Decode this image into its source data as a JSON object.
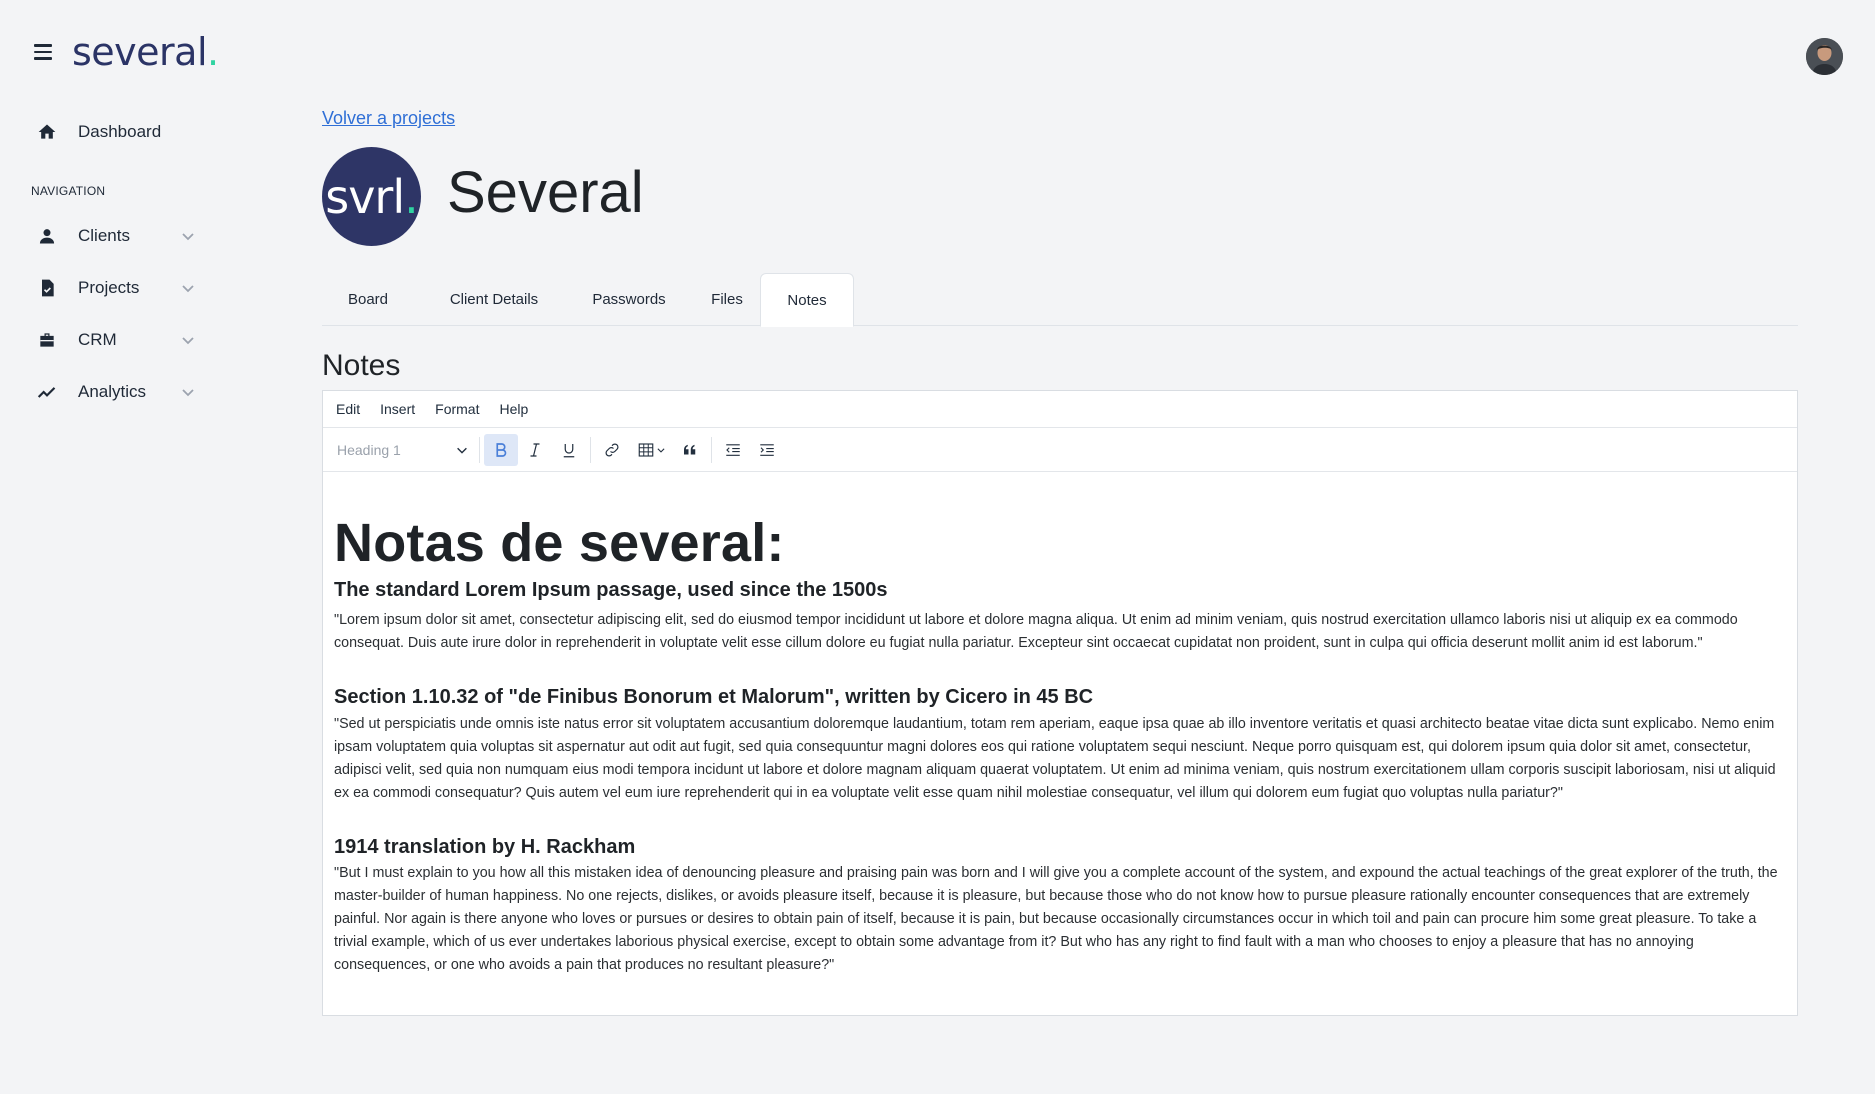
{
  "brand": {
    "name": "several",
    "dot": ".",
    "accent": "#2fd3a1",
    "navy": "#2e3566"
  },
  "sidebar": {
    "dashboard": {
      "label": "Dashboard",
      "icon": "home-icon"
    },
    "nav_heading": "NAVIGATION",
    "items": [
      {
        "label": "Clients",
        "icon": "user-icon"
      },
      {
        "label": "Projects",
        "icon": "clipboard-check-icon"
      },
      {
        "label": "CRM",
        "icon": "briefcase-icon"
      },
      {
        "label": "Analytics",
        "icon": "trending-up-icon"
      }
    ]
  },
  "main": {
    "back_link": "Volver a projects",
    "project": {
      "logo_text": "svrl",
      "logo_dot": ".",
      "title": "Several"
    },
    "tabs": [
      {
        "label": "Board",
        "active": false
      },
      {
        "label": "Client Details",
        "active": false
      },
      {
        "label": "Passwords",
        "active": false
      },
      {
        "label": "Files",
        "active": false
      },
      {
        "label": "Notes",
        "active": true
      }
    ],
    "section_title": "Notes"
  },
  "editor": {
    "menu": [
      "Edit",
      "Insert",
      "Format",
      "Help"
    ],
    "block_format": "Heading 1",
    "toolbar_icons": [
      "bold-icon",
      "italic-icon",
      "underline-icon",
      "link-icon",
      "table-icon",
      "quote-icon",
      "outdent-icon",
      "indent-icon"
    ],
    "content": {
      "h1": "Notas de several:",
      "sections": [
        {
          "heading": "The standard Lorem Ipsum passage, used since the 1500s",
          "body": "\"Lorem ipsum dolor sit amet, consectetur adipiscing elit, sed do eiusmod tempor incididunt ut labore et dolore magna aliqua. Ut enim ad minim veniam, quis nostrud exercitation ullamco laboris nisi ut aliquip ex ea commodo consequat. Duis aute irure dolor in reprehenderit in voluptate velit esse cillum dolore eu fugiat nulla pariatur. Excepteur sint occaecat cupidatat non proident, sunt in culpa qui officia deserunt mollit anim id est laborum.\""
        },
        {
          "heading": "Section 1.10.32 of \"de Finibus Bonorum et Malorum\", written by Cicero in 45 BC",
          "body": "\"Sed ut perspiciatis unde omnis iste natus error sit voluptatem accusantium doloremque laudantium, totam rem aperiam, eaque ipsa quae ab illo inventore veritatis et quasi architecto beatae vitae dicta sunt explicabo. Nemo enim ipsam voluptatem quia voluptas sit aspernatur aut odit aut fugit, sed quia consequuntur magni dolores eos qui ratione voluptatem sequi nesciunt. Neque porro quisquam est, qui dolorem ipsum quia dolor sit amet, consectetur, adipisci velit, sed quia non numquam eius modi tempora incidunt ut labore et dolore magnam aliquam quaerat voluptatem. Ut enim ad minima veniam, quis nostrum exercitationem ullam corporis suscipit laboriosam, nisi ut aliquid ex ea commodi consequatur? Quis autem vel eum iure reprehenderit qui in ea voluptate velit esse quam nihil molestiae consequatur, vel illum qui dolorem eum fugiat quo voluptas nulla pariatur?\""
        },
        {
          "heading": "1914 translation by H. Rackham",
          "body": "\"But I must explain to you how all this mistaken idea of denouncing pleasure and praising pain was born and I will give you a complete account of the system, and expound the actual teachings of the great explorer of the truth, the master-builder of human happiness. No one rejects, dislikes, or avoids pleasure itself, because it is pleasure, but because those who do not know how to pursue pleasure rationally encounter consequences that are extremely painful. Nor again is there anyone who loves or pursues or desires to obtain pain of itself, because it is pain, but because occasionally circumstances occur in which toil and pain can procure him some great pleasure. To take a trivial example, which of us ever undertakes laborious physical exercise, except to obtain some advantage from it? But who has any right to find fault with a man who chooses to enjoy a pleasure that has no annoying consequences, or one who avoids a pain that produces no resultant pleasure?\""
        }
      ]
    }
  }
}
